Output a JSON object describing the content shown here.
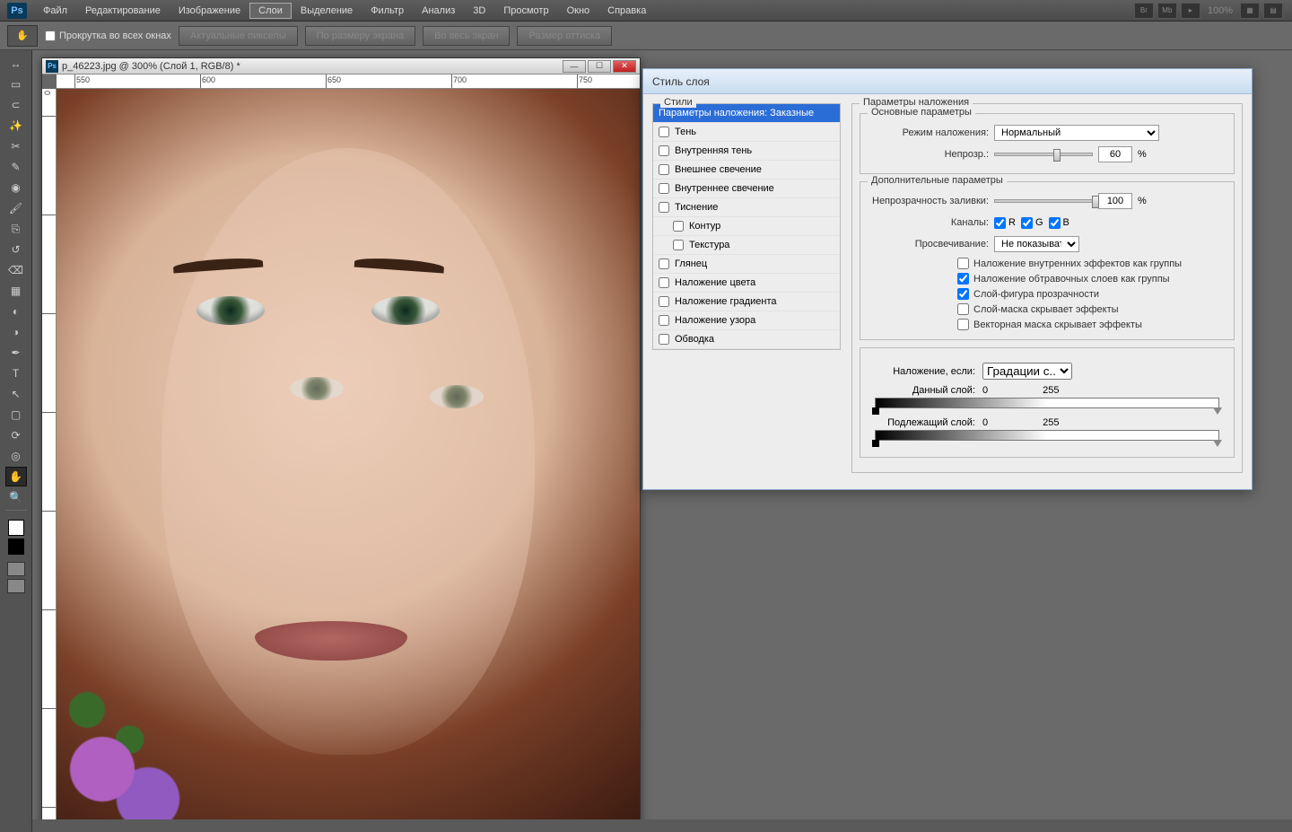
{
  "app": {
    "logo": "Ps"
  },
  "menu": {
    "items": [
      "Файл",
      "Редактирование",
      "Изображение",
      "Слои",
      "Выделение",
      "Фильтр",
      "Анализ",
      "3D",
      "Просмотр",
      "Окно",
      "Справка"
    ],
    "highlighted_index": 3,
    "right_icons": [
      "Br",
      "Mb",
      "film-icon"
    ],
    "zoom_pct": "100%"
  },
  "options_bar": {
    "scroll_all_windows": "Прокрутка во всех окнах",
    "buttons": [
      "Актуальные пикселы",
      "По размеру экрана",
      "Во весь экран",
      "Размер оттиска"
    ]
  },
  "tools": [
    "move",
    "marquee",
    "lasso",
    "wand",
    "crop",
    "eyedropper",
    "spot-heal",
    "brush",
    "clone",
    "history-brush",
    "eraser",
    "gradient",
    "blur",
    "dodge",
    "pen",
    "type",
    "path-select",
    "rectangle",
    "3d-rotate",
    "3d-orbit",
    "hand",
    "zoom"
  ],
  "selected_tool_index": 20,
  "document": {
    "title": "p_46223.jpg @ 300% (Слой 1, RGB/8) *",
    "ruler_ticks": [
      "550",
      "600",
      "650",
      "700",
      "750"
    ],
    "ruler_left_top": "0"
  },
  "dialog": {
    "title": "Стиль слоя",
    "styles_header": "Стили",
    "style_rows": [
      {
        "label": "Параметры наложения: Заказные",
        "checkbox": false,
        "selected": true
      },
      {
        "label": "Тень",
        "checkbox": true
      },
      {
        "label": "Внутренняя тень",
        "checkbox": true
      },
      {
        "label": "Внешнее свечение",
        "checkbox": true
      },
      {
        "label": "Внутреннее свечение",
        "checkbox": true
      },
      {
        "label": "Тиснение",
        "checkbox": true
      },
      {
        "label": "Контур",
        "checkbox": true,
        "sub": true
      },
      {
        "label": "Текстура",
        "checkbox": true,
        "sub": true
      },
      {
        "label": "Глянец",
        "checkbox": true
      },
      {
        "label": "Наложение цвета",
        "checkbox": true
      },
      {
        "label": "Наложение градиента",
        "checkbox": true
      },
      {
        "label": "Наложение узора",
        "checkbox": true
      },
      {
        "label": "Обводка",
        "checkbox": true
      }
    ],
    "params": {
      "group_header": "Параметры наложения",
      "basic_header": "Основные параметры",
      "blend_mode_label": "Режим наложения:",
      "blend_mode_value": "Нормальный",
      "opacity_label": "Непрозр.:",
      "opacity_value": "60",
      "opacity_pct": "%",
      "advanced_header": "Дополнительные параметры",
      "fill_label": "Непрозрачность заливки:",
      "fill_value": "100",
      "channels_label": "Каналы:",
      "channel_r": "R",
      "channel_g": "G",
      "channel_b": "B",
      "knockout_label": "Просвечивание:",
      "knockout_value": "Не показывать",
      "checks": [
        {
          "text": "Наложение внутренних эффектов как группы",
          "on": false
        },
        {
          "text": "Наложение обтравочных слоев как группы",
          "on": true
        },
        {
          "text": "Слой-фигура прозрачности",
          "on": true
        },
        {
          "text": "Слой-маска скрывает эффекты",
          "on": false
        },
        {
          "text": "Векторная маска скрывает эффекты",
          "on": false
        }
      ],
      "blendif_label": "Наложение, если:",
      "blendif_value": "Градации с...",
      "this_layer_label": "Данный слой:",
      "this_lo": "0",
      "this_hi": "255",
      "under_layer_label": "Подлежащий слой:",
      "under_lo": "0",
      "under_hi": "255"
    }
  }
}
